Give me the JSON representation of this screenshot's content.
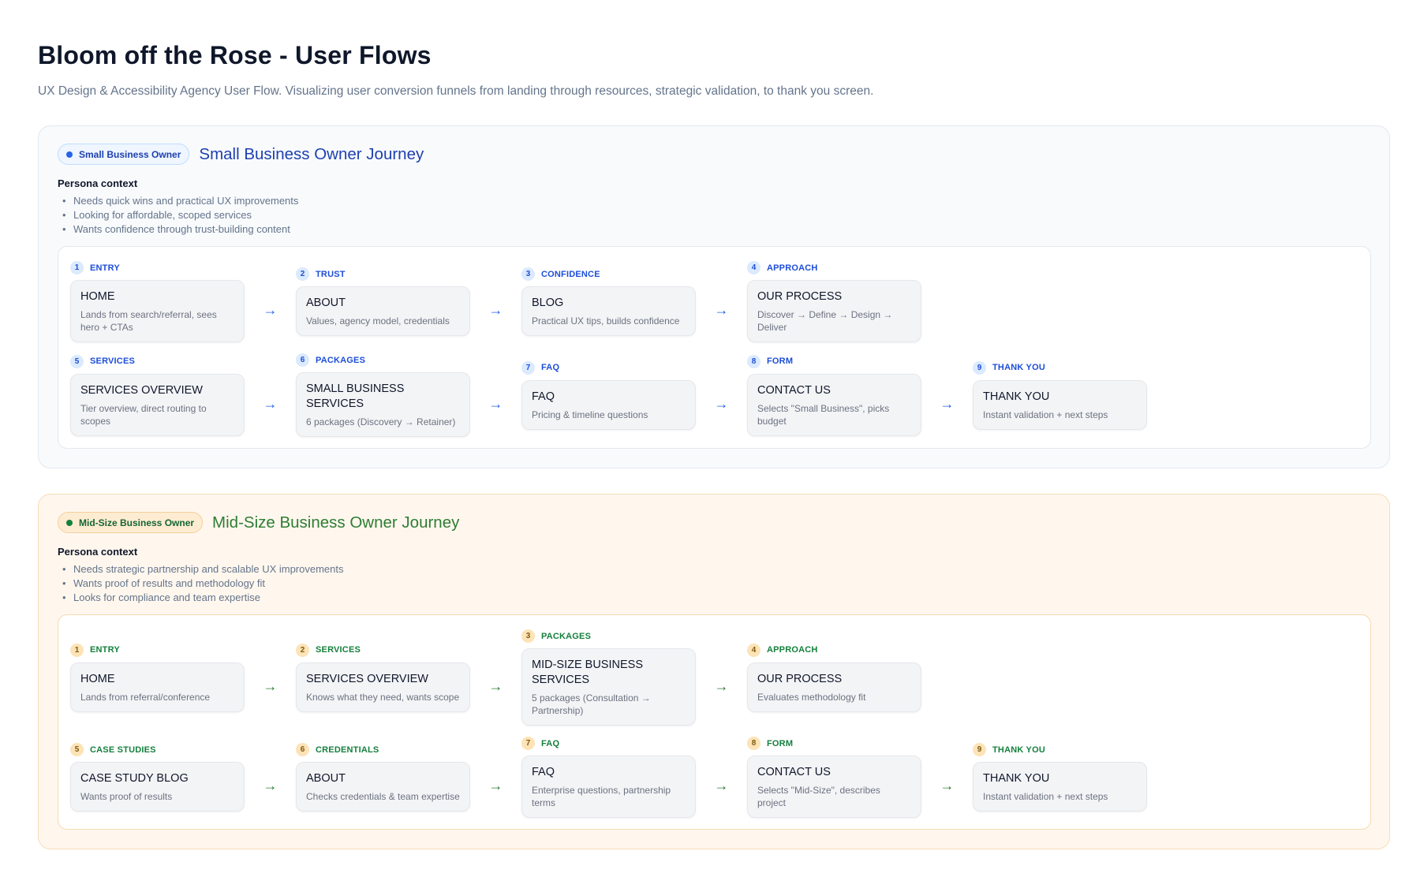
{
  "page": {
    "title": "Bloom off the Rose - User Flows",
    "subtitle": "UX Design & Accessibility Agency User Flow. Visualizing user conversion funnels from landing through resources, strategic validation, to thank you screen."
  },
  "colors": {
    "small_accent": "#2563eb",
    "mid_accent": "#2e7d32",
    "mid_background": "#fff7ee"
  },
  "icons": {
    "dot": "dot-icon",
    "arrow": "arrow-right-icon"
  },
  "arrow_glyph": "→",
  "journeys": [
    {
      "badge": "Small Business Owner",
      "title": "Small Business Owner Journey",
      "persona_label": "Persona context",
      "persona": [
        "Needs quick wins and practical UX improvements",
        "Looking for affordable, scoped services",
        "Wants confidence through trust-building content"
      ],
      "rows": [
        [
          {
            "num": "1",
            "stage": "ENTRY",
            "title": "HOME",
            "desc": "Lands from search/referral, sees hero + CTAs"
          },
          {
            "num": "2",
            "stage": "TRUST",
            "title": "ABOUT",
            "desc": "Values, agency model, credentials"
          },
          {
            "num": "3",
            "stage": "CONFIDENCE",
            "title": "BLOG",
            "desc": "Practical UX tips, builds confidence"
          },
          {
            "num": "4",
            "stage": "APPROACH",
            "title": "OUR PROCESS",
            "desc": "Discover → Define → Design → Deliver"
          }
        ],
        [
          {
            "num": "5",
            "stage": "SERVICES",
            "title": "SERVICES OVERVIEW",
            "desc": "Tier overview, direct routing to scopes"
          },
          {
            "num": "6",
            "stage": "PACKAGES",
            "title": "SMALL BUSINESS SERVICES",
            "desc": "6 packages (Discovery → Retainer)"
          },
          {
            "num": "7",
            "stage": "FAQ",
            "title": "FAQ",
            "desc": "Pricing & timeline questions"
          },
          {
            "num": "8",
            "stage": "FORM",
            "title": "CONTACT US",
            "desc": "Selects \"Small Business\", picks budget"
          },
          {
            "num": "9",
            "stage": "THANK YOU",
            "title": "THANK YOU",
            "desc": "Instant validation + next steps"
          }
        ]
      ]
    },
    {
      "badge": "Mid-Size Business Owner",
      "title": "Mid-Size Business Owner Journey",
      "persona_label": "Persona context",
      "persona": [
        "Needs strategic partnership and scalable UX improvements",
        "Wants proof of results and methodology fit",
        "Looks for compliance and team expertise"
      ],
      "rows": [
        [
          {
            "num": "1",
            "stage": "ENTRY",
            "title": "HOME",
            "desc": "Lands from referral/conference"
          },
          {
            "num": "2",
            "stage": "SERVICES",
            "title": "SERVICES OVERVIEW",
            "desc": "Knows what they need, wants scope"
          },
          {
            "num": "3",
            "stage": "PACKAGES",
            "title": "MID-SIZE BUSINESS SERVICES",
            "desc": "5 packages (Consultation → Partnership)"
          },
          {
            "num": "4",
            "stage": "APPROACH",
            "title": "OUR PROCESS",
            "desc": "Evaluates methodology fit"
          }
        ],
        [
          {
            "num": "5",
            "stage": "CASE STUDIES",
            "title": "CASE STUDY BLOG",
            "desc": "Wants proof of results"
          },
          {
            "num": "6",
            "stage": "CREDENTIALS",
            "title": "ABOUT",
            "desc": "Checks credentials & team expertise"
          },
          {
            "num": "7",
            "stage": "FAQ",
            "title": "FAQ",
            "desc": "Enterprise questions, partnership terms"
          },
          {
            "num": "8",
            "stage": "FORM",
            "title": "CONTACT US",
            "desc": "Selects \"Mid-Size\", describes project"
          },
          {
            "num": "9",
            "stage": "THANK YOU",
            "title": "THANK YOU",
            "desc": "Instant validation + next steps"
          }
        ]
      ]
    }
  ]
}
